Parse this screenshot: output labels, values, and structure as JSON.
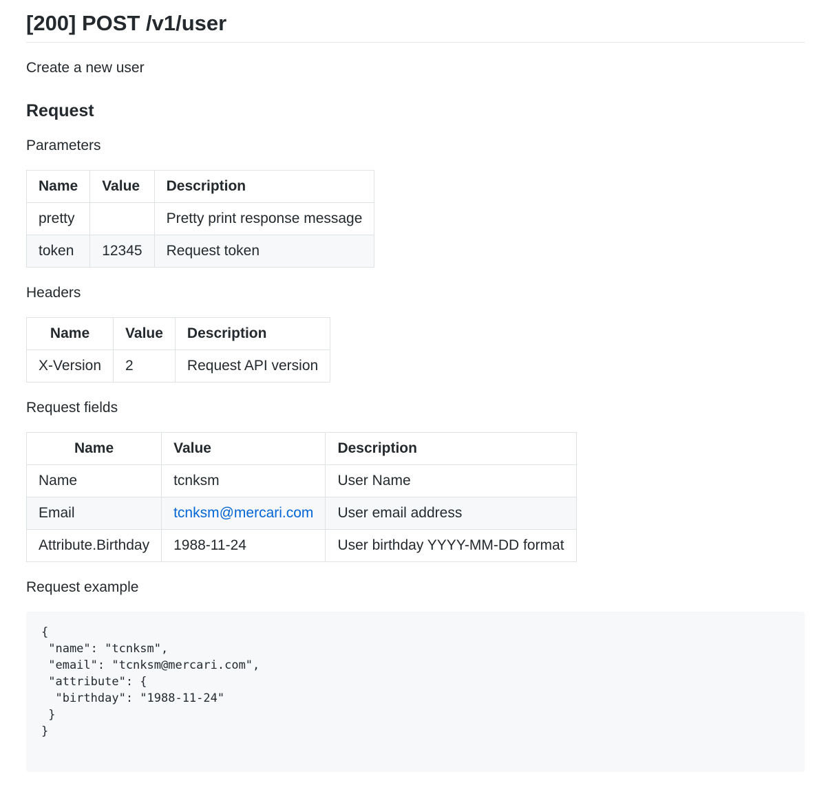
{
  "title": "[200] POST /v1/user",
  "description": "Create a new user",
  "request_heading": "Request",
  "parameters": {
    "label": "Parameters",
    "columns": [
      "Name",
      "Value",
      "Description"
    ],
    "rows": [
      [
        "pretty",
        "",
        "Pretty print response message"
      ],
      [
        "token",
        "12345",
        "Request token"
      ]
    ]
  },
  "headers": {
    "label": "Headers",
    "columns": [
      "Name",
      "Value",
      "Description"
    ],
    "rows": [
      [
        "X-Version",
        "2",
        "Request API version"
      ]
    ]
  },
  "request_fields": {
    "label": "Request fields",
    "columns": [
      "Name",
      "Value",
      "Description"
    ],
    "rows": [
      [
        "Name",
        "tcnksm",
        "User Name"
      ],
      [
        "Email",
        "tcnksm@mercari.com",
        "User email address"
      ],
      [
        "Attribute.Birthday",
        "1988-11-24",
        "User birthday YYYY-MM-DD format"
      ]
    ]
  },
  "request_example": {
    "label": "Request example",
    "code": "{\n \"name\": \"tcnksm\",\n \"email\": \"tcnksm@mercari.com\",\n \"attribute\": {\n  \"birthday\": \"1988-11-24\"\n }\n}"
  },
  "colors": {
    "text": "#24292e",
    "link": "#0366d6",
    "code_bg": "#f6f8fa",
    "border": "#dfe2e5"
  }
}
